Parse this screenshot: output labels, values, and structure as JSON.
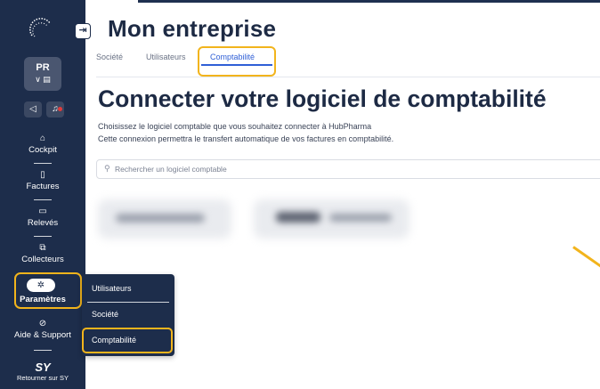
{
  "main": {
    "title": "Mon entreprise",
    "tabs": [
      {
        "label": "Société",
        "active": false
      },
      {
        "label": "Utilisateurs",
        "active": false
      },
      {
        "label": "Comptabilité",
        "active": true
      }
    ],
    "section_title": "Connecter votre logiciel de comptabilité",
    "description_line1": "Choisissez le logiciel comptable que vous souhaitez connecter à HubPharma",
    "description_line2": "Cette connexion permettra le transfert automatique de vos factures en comptabilité.",
    "search": {
      "placeholder": "Rechercher un logiciel comptable",
      "value": ""
    }
  },
  "sidebar": {
    "user_initials": "PR",
    "user_sub": "∨ ▤",
    "nav": [
      {
        "label": "Cockpit",
        "icon": "home-icon"
      },
      {
        "label": "Factures",
        "icon": "document-icon"
      },
      {
        "label": "Relevés",
        "icon": "statement-icon"
      },
      {
        "label": "Collecteurs",
        "icon": "collector-icon"
      },
      {
        "label": "Paramètres",
        "icon": "gear-icon"
      },
      {
        "label": "Aide & Support",
        "icon": "help-icon"
      }
    ],
    "footer": {
      "logo_text": "SY",
      "label": "Retourner sur SY"
    }
  },
  "flyout": {
    "items": [
      {
        "label": "Utilisateurs"
      },
      {
        "label": "Société"
      },
      {
        "label": "Comptabilité"
      }
    ]
  },
  "colors": {
    "sidebar_bg": "#1d2d4b",
    "highlight": "#f2b41c",
    "accent": "#2f5fd6",
    "alert": "#e23b3b"
  }
}
